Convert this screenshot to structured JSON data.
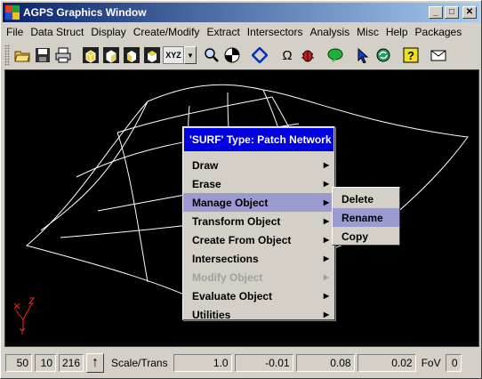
{
  "window": {
    "title": "AGPS Graphics Window"
  },
  "menubar": [
    {
      "label": "File"
    },
    {
      "label": "Data Struct"
    },
    {
      "label": "Display"
    },
    {
      "label": "Create/Modify"
    },
    {
      "label": "Extract"
    },
    {
      "label": "Intersectors"
    },
    {
      "label": "Analysis"
    },
    {
      "label": "Misc"
    },
    {
      "label": "Help"
    },
    {
      "label": "Packages"
    }
  ],
  "toolbar": {
    "xyz_label": "XYZ"
  },
  "context_menu": {
    "header": "'SURF'  Type: Patch Network",
    "items": [
      {
        "label": "Draw"
      },
      {
        "label": "Erase"
      },
      {
        "label": "Manage Object"
      },
      {
        "label": "Transform Object"
      },
      {
        "label": "Create From Object"
      },
      {
        "label": "Intersections"
      },
      {
        "label": "Modify Object"
      },
      {
        "label": "Evaluate Object"
      },
      {
        "label": "Utilities"
      }
    ],
    "highlighted": "Manage Object",
    "disabled": "Modify Object"
  },
  "submenu": {
    "items": [
      {
        "label": "Delete"
      },
      {
        "label": "Rename"
      },
      {
        "label": "Copy"
      }
    ],
    "highlighted": "Rename"
  },
  "statusbar": {
    "field1": "50",
    "field2": "10",
    "field3": "216",
    "mode_label": "Scale/Trans",
    "val1": "1.0",
    "val2": "-0.01",
    "val3": "0.08",
    "val4": "0.02",
    "fov_label": "FoV",
    "fov_value": "0"
  },
  "colors": {
    "menu_header": "#0000e0",
    "highlight": "#9b9bd2",
    "canvas": "#000000",
    "axis": "#ff2020"
  }
}
